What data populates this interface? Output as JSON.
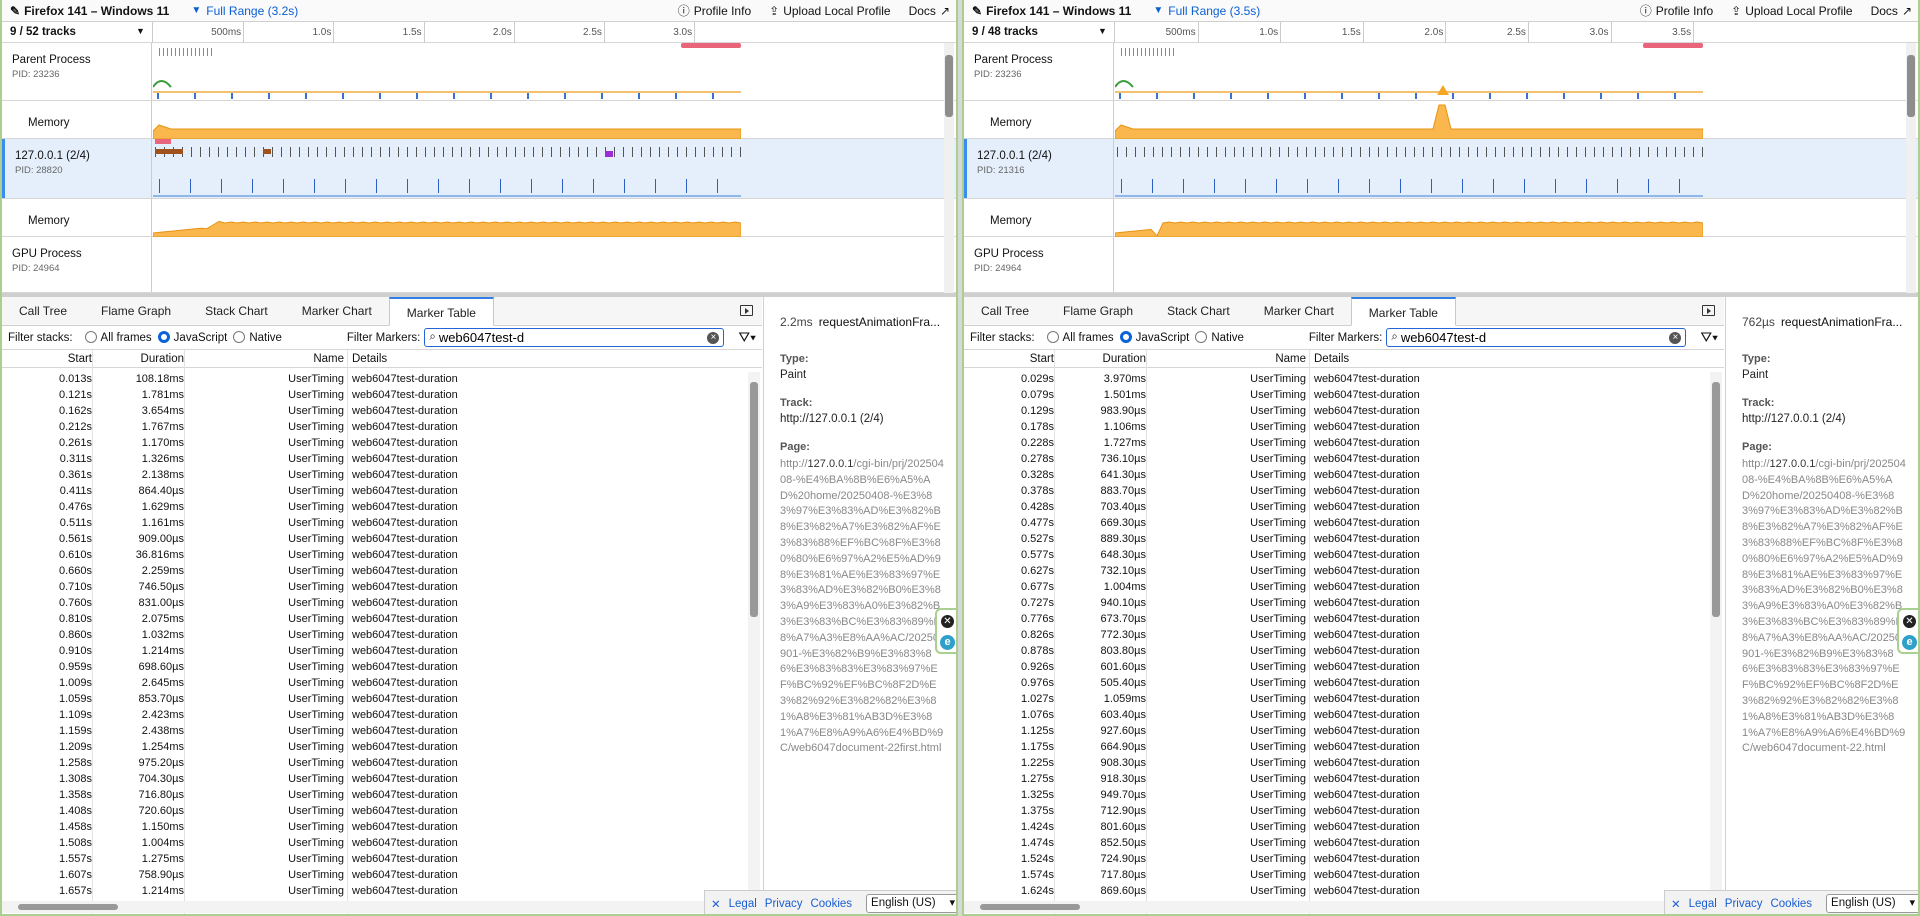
{
  "left": {
    "title": "Firefox 141 – Windows 11",
    "range": "Full Range (3.2s)",
    "profile_info": "Profile Info",
    "upload": "Upload Local Profile",
    "docs": "Docs",
    "track_count": "9 / 52 tracks",
    "ticks": [
      "500ms",
      "1.0s",
      "1.5s",
      "2.0s",
      "2.5s",
      "3.0s"
    ],
    "tracks": [
      {
        "name": "Parent Process",
        "pid": "PID: 23236"
      },
      {
        "name": "Memory"
      },
      {
        "name": "127.0.0.1 (2/4)",
        "pid": "PID: 28820"
      },
      {
        "name": "Memory"
      },
      {
        "name": "GPU Process",
        "pid": "PID: 24964"
      }
    ],
    "tabs": [
      "Call Tree",
      "Flame Graph",
      "Stack Chart",
      "Marker Chart",
      "Marker Table"
    ],
    "active_tab": 4,
    "filter_stacks_label": "Filter stacks:",
    "radio_labels": [
      "All frames",
      "JavaScript",
      "Native"
    ],
    "filter_markers_label": "Filter Markers:",
    "search_value": "web6047test-d",
    "columns": [
      "Start",
      "Duration",
      "Name",
      "Details"
    ],
    "rows": [
      [
        "0.013s",
        "108.18ms"
      ],
      [
        "0.121s",
        "1.781ms"
      ],
      [
        "0.162s",
        "3.654ms"
      ],
      [
        "0.212s",
        "1.767ms"
      ],
      [
        "0.261s",
        "1.170ms"
      ],
      [
        "0.311s",
        "1.326ms"
      ],
      [
        "0.361s",
        "2.138ms"
      ],
      [
        "0.411s",
        "864.40µs"
      ],
      [
        "0.476s",
        "1.629ms"
      ],
      [
        "0.511s",
        "1.161ms"
      ],
      [
        "0.561s",
        "909.00µs"
      ],
      [
        "0.610s",
        "36.816ms"
      ],
      [
        "0.660s",
        "2.259ms"
      ],
      [
        "0.710s",
        "746.50µs"
      ],
      [
        "0.760s",
        "831.00µs"
      ],
      [
        "0.810s",
        "2.075ms"
      ],
      [
        "0.860s",
        "1.032ms"
      ],
      [
        "0.910s",
        "1.214ms"
      ],
      [
        "0.959s",
        "698.60µs"
      ],
      [
        "1.009s",
        "2.645ms"
      ],
      [
        "1.059s",
        "853.70µs"
      ],
      [
        "1.109s",
        "2.423ms"
      ],
      [
        "1.159s",
        "2.438ms"
      ],
      [
        "1.209s",
        "1.254ms"
      ],
      [
        "1.258s",
        "975.20µs"
      ],
      [
        "1.308s",
        "704.30µs"
      ],
      [
        "1.358s",
        "716.80µs"
      ],
      [
        "1.408s",
        "720.60µs"
      ],
      [
        "1.458s",
        "1.150ms"
      ],
      [
        "1.508s",
        "1.004ms"
      ],
      [
        "1.557s",
        "1.275ms"
      ],
      [
        "1.607s",
        "758.90µs"
      ],
      [
        "1.657s",
        "1.214ms"
      ]
    ],
    "row_name": "UserTiming",
    "row_details": "web6047test-duration",
    "side": {
      "duration": "2.2ms",
      "name": "requestAnimationFra...",
      "type_label": "Type:",
      "type": "Paint",
      "track_label": "Track:",
      "track": "http://127.0.0.1 (2/4)",
      "page_label": "Page:",
      "url_prefix": "http://",
      "url_host": "127.0.0.1",
      "url_rest": "/cgi-bin/prj/20250408-%E4%BA%8B%E6%A5%AD%20home/20250408-%E3%83%97%E3%83%AD%E3%82%B8%E3%82%A7%E3%82%AF%E3%83%88%EF%BC%8F%E3%80%80%E6%97%A2%E5%AD%98%E3%81%AE%E3%83%97%E3%83%AD%E3%82%B0%E3%83%A9%E3%83%A0%E3%82%B3%E3%83%BC%E3%83%89%E8%A7%A3%E8%AA%AC/20250901-%E3%82%B9%E3%83%86%E3%83%83%E3%83%97%EF%BC%92%EF%BC%8F2D%E3%82%92%E3%82%82%E3%81%A8%E3%81%AB3D%E3%81%A7%E8%A9%A6%E4%BD%9C/web6047document-22first.html"
    }
  },
  "right": {
    "title": "Firefox 141 – Windows 11",
    "range": "Full Range (3.5s)",
    "profile_info": "Profile Info",
    "upload": "Upload Local Profile",
    "docs": "Docs",
    "track_count": "9 / 48 tracks",
    "ticks": [
      "500ms",
      "1.0s",
      "1.5s",
      "2.0s",
      "2.5s",
      "3.0s",
      "3.5s"
    ],
    "tracks": [
      {
        "name": "Parent Process",
        "pid": "PID: 23236"
      },
      {
        "name": "Memory"
      },
      {
        "name": "127.0.0.1 (2/4)",
        "pid": "PID: 21316"
      },
      {
        "name": "Memory"
      },
      {
        "name": "GPU Process",
        "pid": "PID: 24964"
      }
    ],
    "tabs": [
      "Call Tree",
      "Flame Graph",
      "Stack Chart",
      "Marker Chart",
      "Marker Table"
    ],
    "active_tab": 4,
    "filter_stacks_label": "Filter stacks:",
    "radio_labels": [
      "All frames",
      "JavaScript",
      "Native"
    ],
    "filter_markers_label": "Filter Markers:",
    "search_value": "web6047test-d",
    "columns": [
      "Start",
      "Duration",
      "Name",
      "Details"
    ],
    "rows": [
      [
        "0.029s",
        "3.970ms"
      ],
      [
        "0.079s",
        "1.501ms"
      ],
      [
        "0.129s",
        "983.90µs"
      ],
      [
        "0.178s",
        "1.106ms"
      ],
      [
        "0.228s",
        "1.727ms"
      ],
      [
        "0.278s",
        "736.10µs"
      ],
      [
        "0.328s",
        "641.30µs"
      ],
      [
        "0.378s",
        "883.70µs"
      ],
      [
        "0.428s",
        "703.40µs"
      ],
      [
        "0.477s",
        "669.30µs"
      ],
      [
        "0.527s",
        "889.30µs"
      ],
      [
        "0.577s",
        "648.30µs"
      ],
      [
        "0.627s",
        "732.10µs"
      ],
      [
        "0.677s",
        "1.004ms"
      ],
      [
        "0.727s",
        "940.10µs"
      ],
      [
        "0.776s",
        "673.70µs"
      ],
      [
        "0.826s",
        "772.30µs"
      ],
      [
        "0.878s",
        "803.80µs"
      ],
      [
        "0.926s",
        "601.60µs"
      ],
      [
        "0.976s",
        "505.40µs"
      ],
      [
        "1.027s",
        "1.059ms"
      ],
      [
        "1.076s",
        "603.40µs"
      ],
      [
        "1.125s",
        "927.60µs"
      ],
      [
        "1.175s",
        "664.90µs"
      ],
      [
        "1.225s",
        "908.30µs"
      ],
      [
        "1.275s",
        "918.30µs"
      ],
      [
        "1.325s",
        "949.70µs"
      ],
      [
        "1.375s",
        "712.90µs"
      ],
      [
        "1.424s",
        "801.60µs"
      ],
      [
        "1.474s",
        "852.50µs"
      ],
      [
        "1.524s",
        "724.90µs"
      ],
      [
        "1.574s",
        "717.80µs"
      ],
      [
        "1.624s",
        "869.60µs"
      ]
    ],
    "row_name": "UserTiming",
    "row_details": "web6047test-duration",
    "side": {
      "duration": "762µs",
      "name": "requestAnimationFra...",
      "type_label": "Type:",
      "type": "Paint",
      "track_label": "Track:",
      "track": "http://127.0.0.1 (2/4)",
      "page_label": "Page:",
      "url_prefix": "http://",
      "url_host": "127.0.0.1",
      "url_rest": "/cgi-bin/prj/20250408-%E4%BA%8B%E6%A5%AD%20home/20250408-%E3%83%97%E3%83%AD%E3%82%B8%E3%82%A7%E3%82%AF%E3%83%88%EF%BC%8F%E3%80%80%E6%97%A2%E5%AD%98%E3%81%AE%E3%83%97%E3%83%AD%E3%82%B0%E3%83%A9%E3%83%A0%E3%82%B3%E3%83%BC%E3%83%89%E8%A7%A3%E8%AA%AC/20250901-%E3%82%B9%E3%83%86%E3%83%83%E3%83%97%EF%BC%92%EF%BC%8F2D%E3%82%92%E3%82%82%E3%81%A8%E3%81%AB3D%E3%81%A7%E8%A9%A6%E4%BD%9C/web6047document-22.html"
    }
  },
  "footer": {
    "legal": "Legal",
    "privacy": "Privacy",
    "cookies": "Cookies",
    "language": "English (US)"
  },
  "colors": {
    "accent": "#0a5fd1",
    "memory": "#f6a623",
    "selection": "#e8657b",
    "tab_active": "#2f7fe6",
    "selected_track": "#e4effb"
  },
  "icons": [
    "pencil-icon",
    "dropdown-triangle-icon",
    "info-icon",
    "upload-icon",
    "external-link-icon",
    "search-icon",
    "clear-icon",
    "filter-funnel-icon",
    "sidebar-toggle-icon",
    "close-icon",
    "extension-e-icon"
  ]
}
